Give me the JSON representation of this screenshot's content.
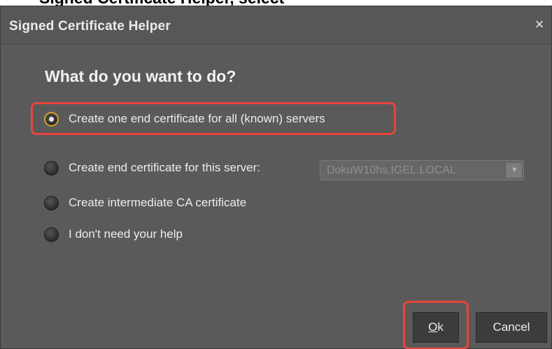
{
  "page_heading_fragment": "Signed Certificate Helper, select",
  "dialog": {
    "title": "Signed Certificate Helper",
    "close_glyph": "×",
    "question": "What do you want to do?",
    "options": [
      {
        "label": "Create one end certificate for all (known) servers",
        "selected": true
      },
      {
        "label": "Create end certificate for this server:",
        "selected": false
      },
      {
        "label": "Create intermediate CA certificate",
        "selected": false
      },
      {
        "label": "I don't need your help",
        "selected": false
      }
    ],
    "server_combo": {
      "value": "DokuW10hs.IGEL.LOCAL",
      "enabled": false
    },
    "buttons": {
      "ok_mnemonic": "O",
      "ok_rest": "k",
      "cancel": "Cancel"
    }
  },
  "colors": {
    "highlight": "#e8453c",
    "radio_selected_ring": "#d9a027",
    "dialog_bg": "#5a5a5a"
  }
}
